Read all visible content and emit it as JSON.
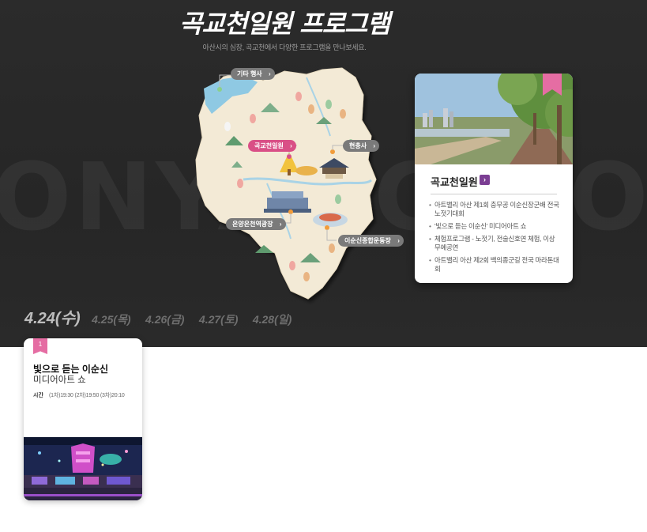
{
  "background_word": "ONYANG GOKGYO",
  "header": {
    "title": "곡교천일원 프로그램",
    "subtitle": "아산시의 심장, 곡교천에서 다양한 프로그램을 만나보세요."
  },
  "map": {
    "labels": {
      "etc": "기타 행사",
      "gokgyo": "곡교천일원",
      "hyeonchungsa": "현충사",
      "onyang": "온양온천역광장",
      "stadium": "이순신종합운동장"
    }
  },
  "info_card": {
    "title": "곡교천일원",
    "button": "›",
    "items": [
      "아트밸리 아산 제1회 충무공 이순신장군배 전국 노젓기대회",
      "'빛으로 듣는 이순신' 미디어아트 쇼",
      "체험프로그램 - 노젓기, 전술신호연 체험, 이상무예공연",
      "아트밸리 아산 제2회 백의종군길 전국 마라톤대회"
    ]
  },
  "dates": [
    "4.24(수)",
    "4.25(목)",
    "4.26(금)",
    "4.27(토)",
    "4.28(일)"
  ],
  "event": {
    "badge": "1",
    "title": "빛으로 듣는 이순신",
    "subtitle": "미디어아트 쇼",
    "time_label": "시간",
    "time_value": "(1차)19:30 (2차)19:50 (3차)20:10"
  },
  "colors": {
    "accent_pink": "#e56da3",
    "accent_purple": "#7b3e93",
    "hero_bg": "#2b2b2b"
  }
}
